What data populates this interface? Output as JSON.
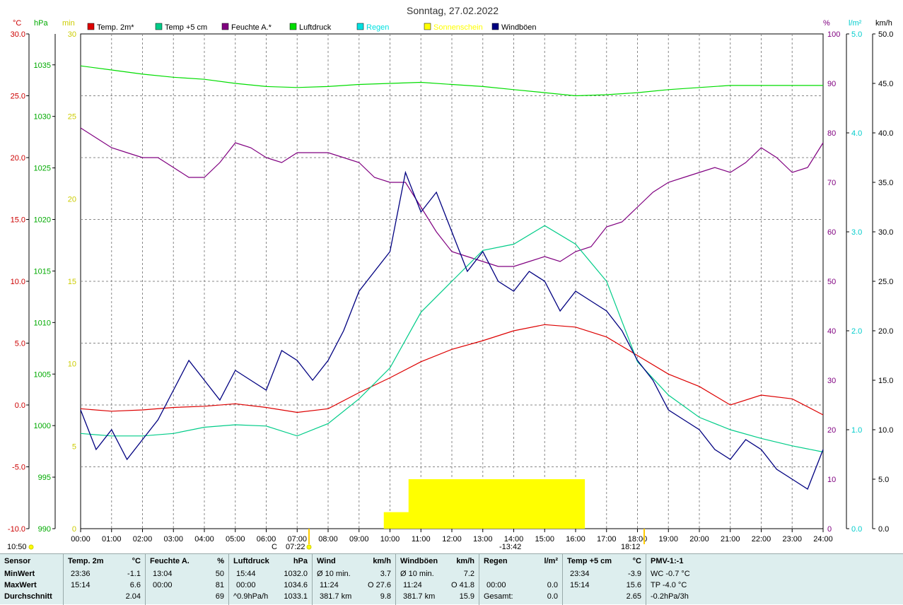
{
  "title": "Sonntag, 27.02.2022",
  "axes": {
    "temp": {
      "unit": "°C",
      "ticks": [
        "30.0",
        "25.0",
        "20.0",
        "15.0",
        "10.0",
        "5.0",
        "0.0",
        "-5.0",
        "-10.0"
      ],
      "min": -10,
      "max": 30,
      "color": "#cc0000"
    },
    "pressure": {
      "unit": "hPa",
      "ticks": [
        "1035",
        "1030",
        "1025",
        "1020",
        "1015",
        "1010",
        "1005",
        "1000",
        "995",
        "990"
      ],
      "min": 990,
      "max": 1038,
      "color": "#00aa00"
    },
    "sun": {
      "unit": "min",
      "ticks": [
        "30",
        "25",
        "20",
        "15",
        "10",
        "5",
        "0"
      ],
      "min": 0,
      "max": 30,
      "color": "#cccc00"
    },
    "humidity": {
      "unit": "%",
      "ticks": [
        "100",
        "90",
        "80",
        "70",
        "60",
        "50",
        "40",
        "30",
        "20",
        "10",
        "0"
      ],
      "min": 0,
      "max": 100,
      "color": "#800080"
    },
    "rain": {
      "unit": "l/m²",
      "ticks": [
        "5.0",
        "4.0",
        "3.0",
        "2.0",
        "1.0",
        "0.0"
      ],
      "min": 0,
      "max": 5,
      "color": "#00cccc"
    },
    "wind": {
      "unit": "km/h",
      "ticks": [
        "50.0",
        "45.0",
        "40.0",
        "35.0",
        "30.0",
        "25.0",
        "20.0",
        "15.0",
        "10.0",
        "5.0",
        "0.0"
      ],
      "min": 0,
      "max": 50,
      "color": "#000080"
    }
  },
  "legend": [
    {
      "label": "Temp. 2m*",
      "color": "#dd0000"
    },
    {
      "label": "Temp +5 cm",
      "color": "#00cc88"
    },
    {
      "label": "Feuchte A.*",
      "color": "#800080"
    },
    {
      "label": "Luftdruck",
      "color": "#00dd00"
    },
    {
      "label": "Regen",
      "color": "#00e0e0"
    },
    {
      "label": "Sonnenschein",
      "color": "#ffff00"
    },
    {
      "label": "Windböen",
      "color": "#000080"
    }
  ],
  "x_ticks": [
    "00:00",
    "01:00",
    "02:00",
    "03:00",
    "04:00",
    "05:00",
    "06:00",
    "07:00",
    "08:00",
    "09:00",
    "10:00",
    "11:00",
    "12:00",
    "13:00",
    "14:00",
    "15:00",
    "16:00",
    "17:00",
    "18:00",
    "19:00",
    "20:00",
    "21:00",
    "22:00",
    "23:00",
    "24:00"
  ],
  "markers": {
    "clock": "10:50",
    "sunrise": "07:22",
    "sunset": "18:12",
    "pmark": "-13:42",
    "cmark": "C"
  },
  "chart_data": {
    "type": "line",
    "x_unit": "hour of day",
    "series": [
      {
        "name": "Luftdruck",
        "axis": "pressure",
        "x": [
          0,
          1,
          2,
          3,
          4,
          5,
          6,
          7,
          8,
          9,
          10,
          11,
          12,
          13,
          14,
          15,
          16,
          17,
          18,
          19,
          20,
          21,
          22,
          23,
          24
        ],
        "y": [
          1034.9,
          1034.5,
          1034.1,
          1033.8,
          1033.6,
          1033.2,
          1032.9,
          1032.8,
          1032.9,
          1033.1,
          1033.2,
          1033.3,
          1033.1,
          1032.9,
          1032.6,
          1032.3,
          1032.0,
          1032.1,
          1032.3,
          1032.6,
          1032.8,
          1033.0,
          1033.0,
          1033.0,
          1033.0
        ]
      },
      {
        "name": "Feuchte A.*",
        "axis": "humidity",
        "x": [
          0,
          0.5,
          1,
          1.5,
          2,
          2.5,
          3,
          3.5,
          4,
          4.5,
          5,
          5.5,
          6,
          6.5,
          7,
          7.5,
          8,
          8.5,
          9,
          9.5,
          10,
          10.5,
          11,
          11.5,
          12,
          12.5,
          13,
          13.5,
          14,
          14.5,
          15,
          15.5,
          16,
          16.5,
          17,
          17.5,
          18,
          18.5,
          19,
          19.5,
          20,
          20.5,
          21,
          21.5,
          22,
          22.5,
          23,
          23.5,
          24
        ],
        "y": [
          81,
          79,
          77,
          76,
          75,
          75,
          73,
          71,
          71,
          74,
          78,
          77,
          75,
          74,
          76,
          76,
          76,
          75,
          74,
          71,
          70,
          70,
          65,
          60,
          56,
          55,
          54,
          53,
          53,
          54,
          55,
          54,
          56,
          57,
          61,
          62,
          65,
          68,
          70,
          71,
          72,
          73,
          72,
          74,
          77,
          75,
          72,
          73,
          78
        ]
      },
      {
        "name": "Temp. 2m*",
        "axis": "temp",
        "x": [
          0,
          1,
          2,
          3,
          4,
          5,
          6,
          7,
          8,
          9,
          10,
          11,
          12,
          13,
          14,
          15,
          16,
          17,
          18,
          19,
          20,
          21,
          22,
          23,
          24
        ],
        "y": [
          -0.3,
          -0.5,
          -0.4,
          -0.2,
          -0.1,
          0.1,
          -0.2,
          -0.6,
          -0.3,
          1.0,
          2.2,
          3.5,
          4.5,
          5.2,
          6.0,
          6.5,
          6.3,
          5.5,
          4.0,
          2.5,
          1.5,
          0.0,
          0.8,
          0.5,
          -0.8
        ]
      },
      {
        "name": "Temp +5 cm",
        "axis": "temp",
        "x": [
          0,
          1,
          2,
          3,
          4,
          5,
          6,
          7,
          8,
          9,
          10,
          11,
          12,
          13,
          14,
          15,
          16,
          17,
          18,
          19,
          20,
          21,
          22,
          23,
          24
        ],
        "y": [
          -2.3,
          -2.5,
          -2.5,
          -2.3,
          -1.8,
          -1.6,
          -1.7,
          -2.5,
          -1.5,
          0.5,
          3.0,
          7.5,
          10.0,
          12.5,
          13.0,
          14.5,
          13.0,
          10.0,
          3.5,
          0.8,
          -1.0,
          -2.0,
          -2.7,
          -3.3,
          -3.8
        ]
      },
      {
        "name": "Windböen",
        "axis": "wind",
        "x": [
          0,
          0.5,
          1,
          1.5,
          2,
          2.5,
          3,
          3.5,
          4,
          4.5,
          5,
          5.5,
          6,
          6.5,
          7,
          7.5,
          8,
          8.5,
          9,
          9.5,
          10,
          10.5,
          11,
          11.5,
          12,
          12.5,
          13,
          13.5,
          14,
          14.5,
          15,
          15.5,
          16,
          16.5,
          17,
          17.5,
          18,
          18.5,
          19,
          19.5,
          20,
          20.5,
          21,
          21.5,
          22,
          22.5,
          23,
          23.5,
          24
        ],
        "y": [
          12,
          8,
          10,
          7,
          9,
          11,
          14,
          17,
          15,
          13,
          16,
          15,
          14,
          18,
          17,
          15,
          17,
          20,
          24,
          26,
          28,
          36,
          32,
          34,
          30,
          26,
          28,
          25,
          24,
          26,
          25,
          22,
          24,
          23,
          22,
          20,
          17,
          15,
          12,
          11,
          10,
          8,
          7,
          9,
          8,
          6,
          5,
          4,
          8
        ]
      },
      {
        "name": "Sonnenschein",
        "axis": "sun",
        "type": "area",
        "x": [
          9.8,
          10.6,
          10.6,
          11.15,
          11.15,
          12,
          13,
          14,
          15,
          16,
          16.3,
          16.3
        ],
        "y": [
          1,
          1,
          3,
          3,
          3,
          3,
          3,
          3,
          3,
          3,
          3,
          0
        ]
      }
    ]
  },
  "stats": {
    "sensor": {
      "header": "Sensor",
      "min": "MinWert",
      "max": "MaxWert",
      "avg": "Durchschnitt"
    },
    "temp2m": {
      "header": "Temp. 2m",
      "unit": "°C",
      "min_time": "23:36",
      "min_val": "-1.1",
      "max_time": "15:14",
      "max_val": "6.6",
      "avg_val": "2.04"
    },
    "feuchte": {
      "header": "Feuchte A.",
      "unit": "%",
      "min_time": "13:04",
      "min_val": "50",
      "max_time": "00:00",
      "max_val": "81",
      "avg_val": "69"
    },
    "luftdruck": {
      "header": "Luftdruck",
      "unit": "hPa",
      "min_time": "15:44",
      "min_val": "1032.0",
      "max_time": "00:00",
      "max_val": "1034.6",
      "avg_label": "^0.9hPa/h",
      "avg_val": "1033.1"
    },
    "wind": {
      "header": "Wind",
      "unit": "km/h",
      "min_time": "Ø 10 min.",
      "min_val": "3.7",
      "max_time": "11:24",
      "max_val": "O 27.6",
      "avg_label": "381.7 km",
      "avg_val": "9.8"
    },
    "windboeen": {
      "header": "Windböen",
      "unit": "km/h",
      "min_time": "Ø 10 min.",
      "min_val": "7.2",
      "max_time": "11:24",
      "max_val": "O 41.8",
      "avg_label": "381.7 km",
      "avg_val": "15.9"
    },
    "regen": {
      "header": "Regen",
      "unit": "l/m²",
      "max_time": "00:00",
      "max_val": "0.0",
      "avg_label": "Gesamt:",
      "avg_val": "0.0"
    },
    "temp5cm": {
      "header": "Temp +5 cm",
      "unit": "°C",
      "min_time": "23:34",
      "min_val": "-3.9",
      "max_time": "15:14",
      "max_val": "15.6",
      "avg_val": "2.65"
    },
    "pmv": {
      "header": "PMV-1:-1",
      "min_val": "WC -0.7 °C",
      "max_val": "TP -4.0 °C",
      "avg_val": "-0.2hPa/3h"
    }
  }
}
